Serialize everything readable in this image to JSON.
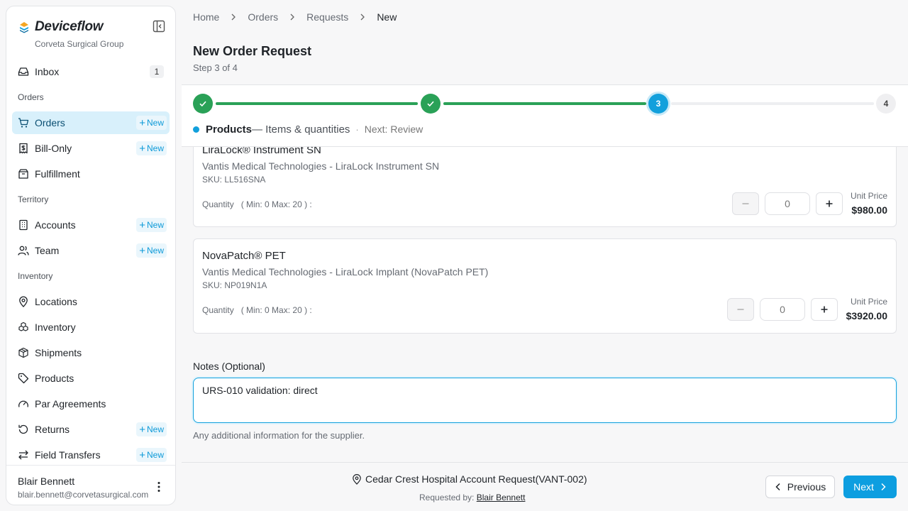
{
  "brand": {
    "name": "Deviceflow",
    "org": "Corveta Surgical Group"
  },
  "sidebar": {
    "inbox": {
      "label": "Inbox",
      "count": "1"
    },
    "sections": {
      "orders": "Orders",
      "territory": "Territory",
      "inventory": "Inventory"
    },
    "items": {
      "orders": "Orders",
      "bill_only": "Bill-Only",
      "fulfillment": "Fulfillment",
      "accounts": "Accounts",
      "team": "Team",
      "locations": "Locations",
      "inventory": "Inventory",
      "shipments": "Shipments",
      "products": "Products",
      "par_agreements": "Par Agreements",
      "returns": "Returns",
      "field_transfers": "Field Transfers"
    },
    "new_label": "New",
    "active": "orders"
  },
  "user": {
    "name": "Blair Bennett",
    "email": "blair.bennett@corvetasurgical.com"
  },
  "breadcrumb": [
    "Home",
    "Orders",
    "Requests",
    "New"
  ],
  "page": {
    "title": "New Order Request",
    "step": "Step 3 of 4"
  },
  "stepper": {
    "current_number": "3",
    "last_number": "4",
    "caption_title": "Products",
    "caption_sub": "— Items & quantities",
    "caption_sep": "·",
    "caption_next": "Next: Review"
  },
  "products": [
    {
      "name": "LiraLock® Instrument SN",
      "vendor": "Vantis Medical Technologies - LiraLock Instrument SN",
      "sku": "SKU: LL516SNA",
      "qty_label": "Quantity",
      "qty_range": "( Min: 0 Max: 20 ) :",
      "qty": "0",
      "price_label": "Unit Price",
      "price": "$980.00"
    },
    {
      "name": "NovaPatch® PET",
      "vendor": "Vantis Medical Technologies - LiraLock Implant (NovaPatch PET)",
      "sku": "SKU: NP019N1A",
      "qty_label": "Quantity",
      "qty_range": "( Min: 0 Max: 20 ) :",
      "qty": "0",
      "price_label": "Unit Price",
      "price": "$3920.00"
    }
  ],
  "notes": {
    "label": "Notes (Optional)",
    "value": "URS-010 validation: direct",
    "help": "Any additional information for the supplier."
  },
  "footer": {
    "account": "Cedar Crest Hospital Account Request(VANT-002)",
    "requested_by_label": "Requested by:",
    "requested_by": "Blair Bennett",
    "prev": "Previous",
    "next": "Next"
  },
  "colors": {
    "accent": "#0d9ee0",
    "success": "#2aa157",
    "active_nav": "#d8f0fb"
  }
}
